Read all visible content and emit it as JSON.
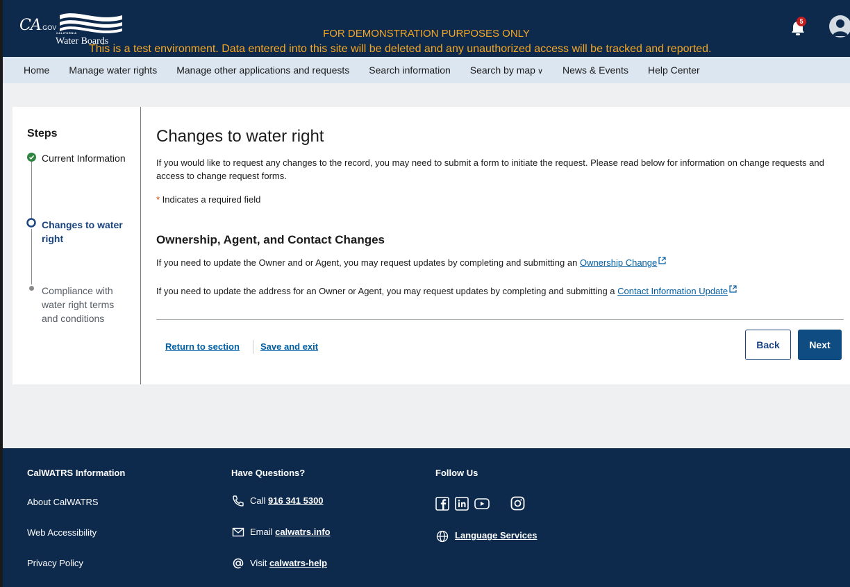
{
  "header": {
    "ca_logo": "CA",
    "ca_logo_suffix": ".GOV",
    "agency_small": "CALIFORNIA",
    "agency_name": "Water Boards",
    "demo_line1": "FOR DEMONSTRATION PURPOSES ONLY",
    "demo_line2": "This is a test environment. Data entered into this site will be deleted and any unauthorized access will be tracked and reported.",
    "notification_count": "5"
  },
  "nav": {
    "items": [
      {
        "label": "Home"
      },
      {
        "label": "Manage water rights"
      },
      {
        "label": "Manage other applications and requests"
      },
      {
        "label": "Search information"
      },
      {
        "label": "Search by map"
      },
      {
        "label": "News & Events"
      },
      {
        "label": "Help Center"
      }
    ]
  },
  "steps": {
    "title": "Steps",
    "items": [
      {
        "label": "Current Information",
        "status": "complete"
      },
      {
        "label": "Changes to water right",
        "status": "current"
      },
      {
        "label": "Compliance with water right terms and conditions",
        "status": "pending"
      }
    ]
  },
  "main": {
    "title": "Changes to water right",
    "intro": "If you would like to request any changes to the record, you may need to submit a form to initiate the request. Please read below for information on change requests and access to change request forms.",
    "required_marker": "*",
    "required_note": " Indicates a required field",
    "section_title": "Ownership, Agent, and Contact Changes",
    "para1_text": "If you need to update the Owner and or Agent, you may request updates by completing and submitting an ",
    "para1_link": "Ownership Change",
    "para2_text": "If you need to update the address for an Owner or Agent, you may request updates by completing and submitting a ",
    "para2_link": "Contact Information Update",
    "return_label": "Return to section",
    "save_exit_label": "Save and exit",
    "back_label": "Back",
    "next_label": "Next"
  },
  "footer": {
    "col1_title": "CalWATRS Information",
    "col1_links": [
      "About CalWATRS",
      "Web Accessibility",
      "Privacy Policy"
    ],
    "col2_title": "Have Questions?",
    "call_prefix": "Call ",
    "call_link": "916 341 5300",
    "email_prefix": "Email ",
    "email_link": "calwatrs.info",
    "visit_prefix": "Visit ",
    "visit_link": "calwatrs-help",
    "col3_title": "Follow Us",
    "language_link": "Language Services"
  },
  "colors": {
    "header_bg": "#0d2a4d",
    "nav_bg": "#dbe6f0",
    "accent": "#0f4c81",
    "demo_text": "#f5a623",
    "link": "#005ea2",
    "complete_green": "#2e8540"
  }
}
